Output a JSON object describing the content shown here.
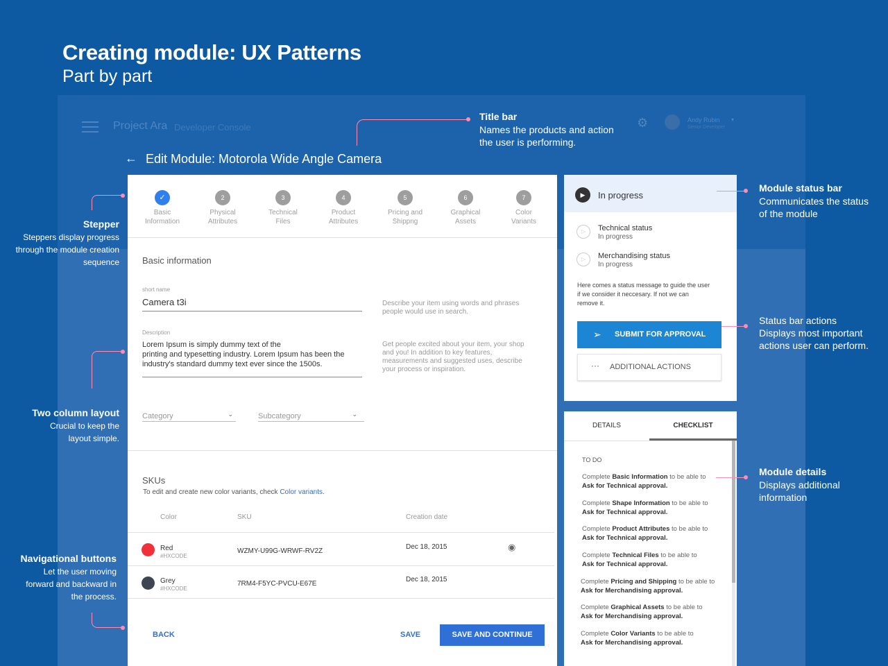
{
  "page": {
    "headline": "Creating module: UX Patterns",
    "subhead": "Part by part"
  },
  "console": {
    "app_name": "Project Ara",
    "app_sub": "Developer Console",
    "user_name": "Andy Rubin",
    "user_role": "Senior Developer"
  },
  "title_bar": {
    "title": "Edit Module: Motorola Wide Angle Camera"
  },
  "stepper": {
    "active_mark": "✓",
    "steps": [
      {
        "num": "1",
        "line1": "Basic",
        "line2": "Information"
      },
      {
        "num": "2",
        "line1": "Physical",
        "line2": "Attributes"
      },
      {
        "num": "3",
        "line1": "Technical",
        "line2": "Files"
      },
      {
        "num": "4",
        "line1": "Product",
        "line2": "Attributes"
      },
      {
        "num": "5",
        "line1": "Pricing and",
        "line2": "Shippng"
      },
      {
        "num": "6",
        "line1": "Graphical",
        "line2": "Assets"
      },
      {
        "num": "7",
        "line1": "Color",
        "line2": "Variants"
      }
    ]
  },
  "basic_info": {
    "section_title": "Basic information",
    "short_name_label": "short name",
    "short_name_value": "Camera t3i",
    "short_name_hint_1": "Describe your item using words and phrases",
    "short_name_hint_2": "people would use in search.",
    "description_label": "Description",
    "description_line_1": "Lorem Ipsum is simply dummy text of the",
    "description_line_2": "printing and typesetting industry. Lorem Ipsum has been the",
    "description_line_3": "industry's standard dummy text ever since the 1500s.",
    "description_hint_1": "Get people excited about your item, your shop",
    "description_hint_2": "and you! In addition to key features,",
    "description_hint_3": "measurements and suggested uses, describe",
    "description_hint_4": "your process or inspiration.",
    "category_placeholder": "Category",
    "subcategory_placeholder": "Subcategory"
  },
  "skus": {
    "section_title": "SKUs",
    "help_prefix": "To edit and create new color variants, check ",
    "help_link": "Color variants",
    "help_suffix": ".",
    "col_color": "Color",
    "col_sku": "SKU",
    "col_date": "Creation date",
    "rows": [
      {
        "color_name": "Red",
        "color_code": "#HXCODE",
        "swatch": "#f0313a",
        "sku": "WZMY-U99G-WRWF-RV2Z",
        "date": "Dec 18, 2015"
      },
      {
        "color_name": "Grey",
        "color_code": "#HXCODE",
        "swatch": "#3f4552",
        "sku": "7RM4-F5YC-PVCU-E67E",
        "date": "Dec 18, 2015"
      }
    ]
  },
  "nav": {
    "back": "BACK",
    "save": "SAVE",
    "save_continue": "SAVE AND CONTINUE"
  },
  "status": {
    "title": "In progress",
    "items": [
      {
        "title": "Technical status",
        "state": "In progress"
      },
      {
        "title": "Merchandising status",
        "state": "In progress"
      }
    ],
    "message_1": "Here comes a status message to guide the user",
    "message_2": "if we consider it neccesary. If not we can",
    "message_3": "remove it.",
    "submit": "SUBMIT FOR APPROVAL",
    "additional": "ADDITIONAL ACTIONS"
  },
  "details": {
    "tab_details": "DETAILS",
    "tab_checklist": "CHECKLIST",
    "todo": "TO DO",
    "items": [
      {
        "pre": "Complete ",
        "bold": "Basic Information",
        "post": " to be able to",
        "line2": "Ask for Technical approval."
      },
      {
        "pre": "Complete ",
        "bold": "Shape Information",
        "post": " to be able to",
        "line2": "Ask for Technical approval."
      },
      {
        "pre": "Complete ",
        "bold": "Product Attributes",
        "post": " to be able to",
        "line2": "Ask for Technical approval."
      },
      {
        "pre": "Complete ",
        "bold": "Technical Files",
        "post": " to be able to",
        "line2": "Ask for Technical approval."
      },
      {
        "pre": "Complete ",
        "bold": "Pricing and Shipping",
        "post": " to be able to",
        "line2": "Ask for Merchandising approval."
      },
      {
        "pre": "Complete ",
        "bold": "Graphical Assets",
        "post": " to be able to",
        "line2": "Ask for Merchandising approval."
      },
      {
        "pre": "Complete ",
        "bold": "Color Variants",
        "post": " to be able to",
        "line2": "Ask for Merchandising approval."
      }
    ]
  },
  "annotations": {
    "title_bar_title": "Title bar",
    "title_bar_1": "Names the products and action",
    "title_bar_2": "the user is performing.",
    "stepper_title": "Stepper",
    "stepper_1": "Steppers display progress",
    "stepper_2": "through the module creation",
    "stepper_3": "sequence",
    "two_col_title": "Two column layout",
    "two_col_1": "Crucial to keep the",
    "two_col_2": "layout simple.",
    "nav_title": "Navigational buttons",
    "nav_1": "Let the user moving",
    "nav_2": "forward and backward in",
    "nav_3": "the process.",
    "status_bar_title": "Module status bar",
    "status_bar_1": "Communicates the status",
    "status_bar_2": "of the module",
    "actions_1": "Status bar actions",
    "actions_2": "Displays  most important",
    "actions_3": "actions user can perform.",
    "details_title": "Module details",
    "details_1": "Displays additional",
    "details_2": "information"
  },
  "icons": {
    "back": "arrow-left-icon",
    "play": "play-icon",
    "send": "send-icon",
    "more": "more-horizontal-icon",
    "eye": "eye-icon",
    "gear": "gear-icon",
    "menu": "menu-icon"
  },
  "colors": {
    "background": "#0d5aa3",
    "primary": "#2f6fd6",
    "submit": "#1d86d4",
    "annotation": "#ff8cb4"
  }
}
